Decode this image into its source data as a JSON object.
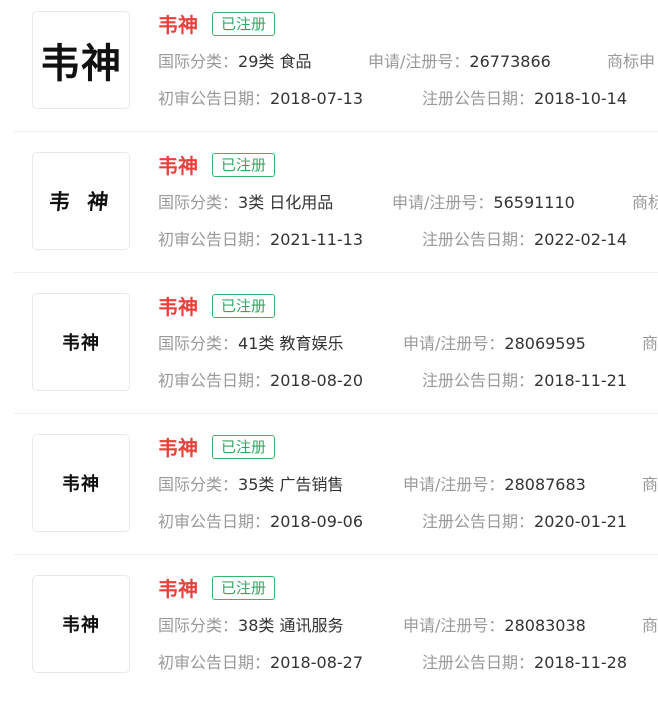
{
  "labels": {
    "class": "国际分类：",
    "reg_no": "申请/注册号：",
    "type": "商标类型",
    "first_trial": "初审公告日期：",
    "reg_date": "注册公告日期："
  },
  "items": [
    {
      "name": "韦神",
      "status": "已注册",
      "logo_text": "韦神",
      "logo_style": "big",
      "class_value": "29类 食品",
      "reg_no": "26773866",
      "type_trunc": "商标申",
      "first_trial": "2018-07-13",
      "reg_date": "2018-10-14"
    },
    {
      "name": "韦神",
      "status": "已注册",
      "logo_text": "韦 神",
      "logo_style": "brush",
      "class_value": "3类 日化用品",
      "reg_no": "56591110",
      "type_trunc": "商标",
      "first_trial": "2021-11-13",
      "reg_date": "2022-02-14"
    },
    {
      "name": "韦神",
      "status": "已注册",
      "logo_text": "韦神",
      "logo_style": "plain",
      "class_value": "41类 教育娱乐",
      "reg_no": "28069595",
      "type_trunc": "商",
      "first_trial": "2018-08-20",
      "reg_date": "2018-11-21"
    },
    {
      "name": "韦神",
      "status": "已注册",
      "logo_text": "韦神",
      "logo_style": "plain",
      "class_value": "35类 广告销售",
      "reg_no": "28087683",
      "type_trunc": "商",
      "first_trial": "2018-09-06",
      "reg_date": "2020-01-21"
    },
    {
      "name": "韦神",
      "status": "已注册",
      "logo_text": "韦神",
      "logo_style": "plain",
      "class_value": "38类 通讯服务",
      "reg_no": "28083038",
      "type_trunc": "商",
      "first_trial": "2018-08-27",
      "reg_date": "2018-11-28"
    }
  ]
}
